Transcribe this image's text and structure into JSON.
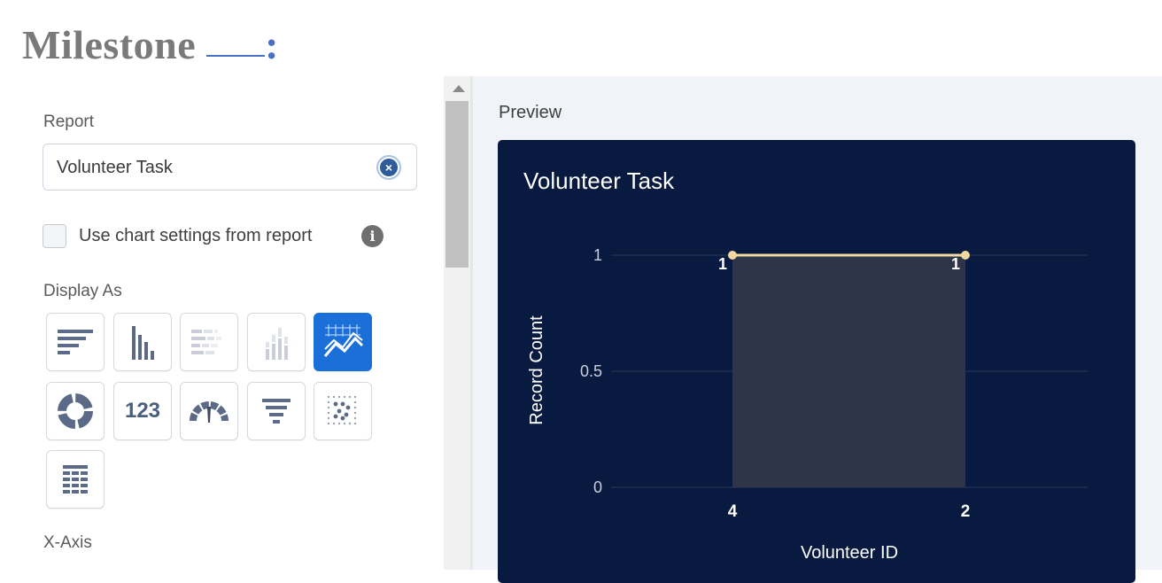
{
  "page": {
    "heading": "Milestone",
    "heading_colon": ":"
  },
  "form": {
    "report_label": "Report",
    "report_value": "Volunteer Task",
    "clear_icon": "clear-circle-icon",
    "use_chart_settings_label": "Use chart settings from report",
    "use_chart_settings_checked": false,
    "display_as_label": "Display As",
    "x_axis_label": "X-Axis",
    "display_types": [
      {
        "name": "horizontal-bar",
        "icon": "horizontal-bar-chart-icon",
        "selected": false,
        "enabled": true
      },
      {
        "name": "vertical-bar",
        "icon": "vertical-bar-chart-icon",
        "selected": false,
        "enabled": true
      },
      {
        "name": "stacked-horizontal-bar",
        "icon": "stacked-horizontal-bar-icon",
        "selected": false,
        "enabled": false
      },
      {
        "name": "stacked-vertical-bar",
        "icon": "stacked-vertical-bar-icon",
        "selected": false,
        "enabled": false
      },
      {
        "name": "line",
        "icon": "line-chart-icon",
        "selected": true,
        "enabled": true
      },
      {
        "name": "donut",
        "icon": "donut-chart-icon",
        "selected": false,
        "enabled": true
      },
      {
        "name": "metric",
        "icon": "metric-icon",
        "selected": false,
        "enabled": true,
        "text": "123"
      },
      {
        "name": "gauge",
        "icon": "gauge-icon",
        "selected": false,
        "enabled": true
      },
      {
        "name": "funnel",
        "icon": "funnel-chart-icon",
        "selected": false,
        "enabled": true
      },
      {
        "name": "scatter",
        "icon": "scatter-plot-icon",
        "selected": false,
        "enabled": true
      },
      {
        "name": "table",
        "icon": "table-icon",
        "selected": false,
        "enabled": true
      }
    ]
  },
  "preview": {
    "label": "Preview"
  },
  "chart_data": {
    "type": "line",
    "title": "Volunteer Task",
    "xlabel": "Volunteer ID",
    "ylabel": "Record Count",
    "categories": [
      "4",
      "2"
    ],
    "values": [
      1,
      1
    ],
    "data_labels": [
      "1",
      "1"
    ],
    "ylim": [
      0,
      1
    ],
    "yticks": [
      "0",
      "0.5",
      "1"
    ],
    "grid": true,
    "colors": {
      "background": "#081a40",
      "line": "#f0d9a0",
      "area": "#2e3548",
      "grid": "#2b3a5e",
      "text": "#ffffff"
    }
  },
  "colors": {
    "accent": "#1b6fd8",
    "icon": "#5b6b87"
  }
}
